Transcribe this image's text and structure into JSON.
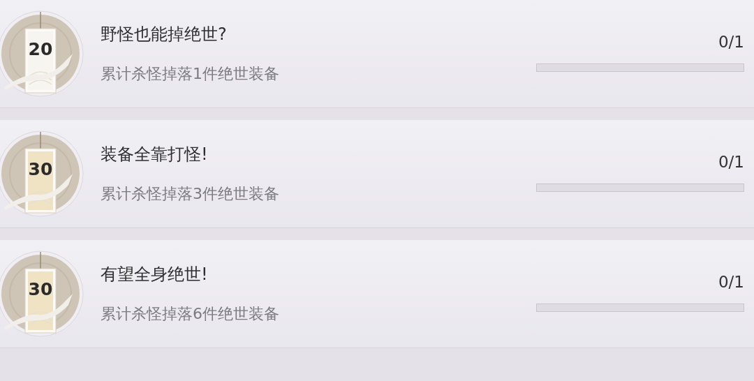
{
  "achievements": [
    {
      "reward": "20",
      "color": "#f7f5f0",
      "title": "野怪也能掉绝世?",
      "description": "累计杀怪掉落1件绝世装备",
      "progress": "0/1",
      "level": 0
    },
    {
      "reward": "30",
      "color": "#efe3c4",
      "title": "装备全靠打怪!",
      "description": "累计杀怪掉落3件绝世装备",
      "progress": "0/1",
      "level": 0
    },
    {
      "reward": "30",
      "color": "#efe3c4",
      "title": "有望全身绝世!",
      "description": "累计杀怪掉落6件绝世装备",
      "progress": "0/1",
      "level": 0
    }
  ]
}
